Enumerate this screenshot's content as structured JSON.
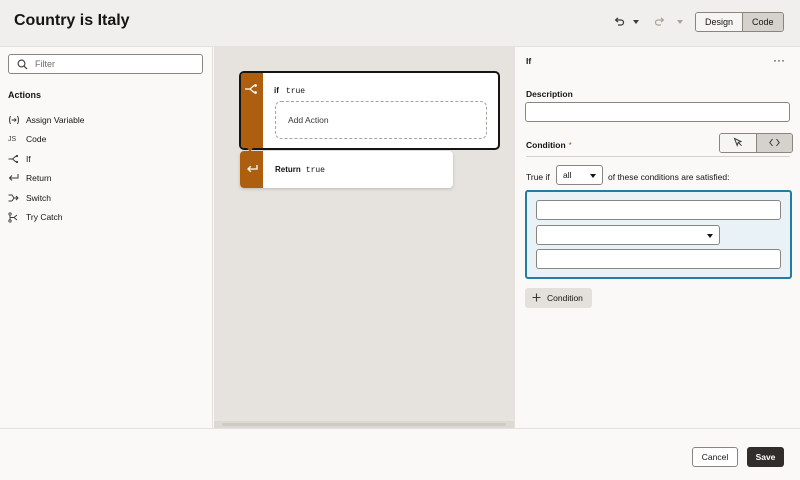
{
  "header": {
    "title": "Country is Italy",
    "undo_icon": "undo-icon",
    "redo_icon": "redo-icon",
    "view_toggle": {
      "design_label": "Design",
      "code_label": "Code",
      "selected": "Code"
    }
  },
  "sidebar": {
    "filter_placeholder": "Filter",
    "actions_heading": "Actions",
    "items": [
      {
        "label": "Assign Variable",
        "icon": "assign-variable-icon",
        "glyph": "(↦)"
      },
      {
        "label": "Code",
        "icon": "code-js-icon",
        "glyph": "JS"
      },
      {
        "label": "If",
        "icon": "if-branch-icon",
        "glyph": ""
      },
      {
        "label": "Return",
        "icon": "return-icon",
        "glyph": "↩"
      },
      {
        "label": "Switch",
        "icon": "switch-icon",
        "glyph": ""
      },
      {
        "label": "Try Catch",
        "icon": "try-catch-icon",
        "glyph": ""
      }
    ]
  },
  "canvas": {
    "if_block": {
      "keyword": "if",
      "expression": "true",
      "add_action_label": "Add Action"
    },
    "return_block": {
      "keyword": "Return",
      "expression": "true"
    }
  },
  "properties": {
    "title": "If",
    "more_label": "···",
    "description_label": "Description",
    "description_value": "",
    "condition_label": "Condition",
    "required_marker": "*",
    "true_if_label": "True if",
    "match_mode": "all",
    "conditions_suffix": "of these conditions are satisfied:",
    "condition_row": {
      "left_operand": "",
      "operator": "",
      "right_operand": ""
    },
    "add_condition_label": "Condition"
  },
  "footer": {
    "cancel_label": "Cancel",
    "save_label": "Save"
  },
  "colors": {
    "accent_brown": "#ae5e0f",
    "focus_teal": "#227e9e",
    "primary_dark": "#312d2a"
  }
}
